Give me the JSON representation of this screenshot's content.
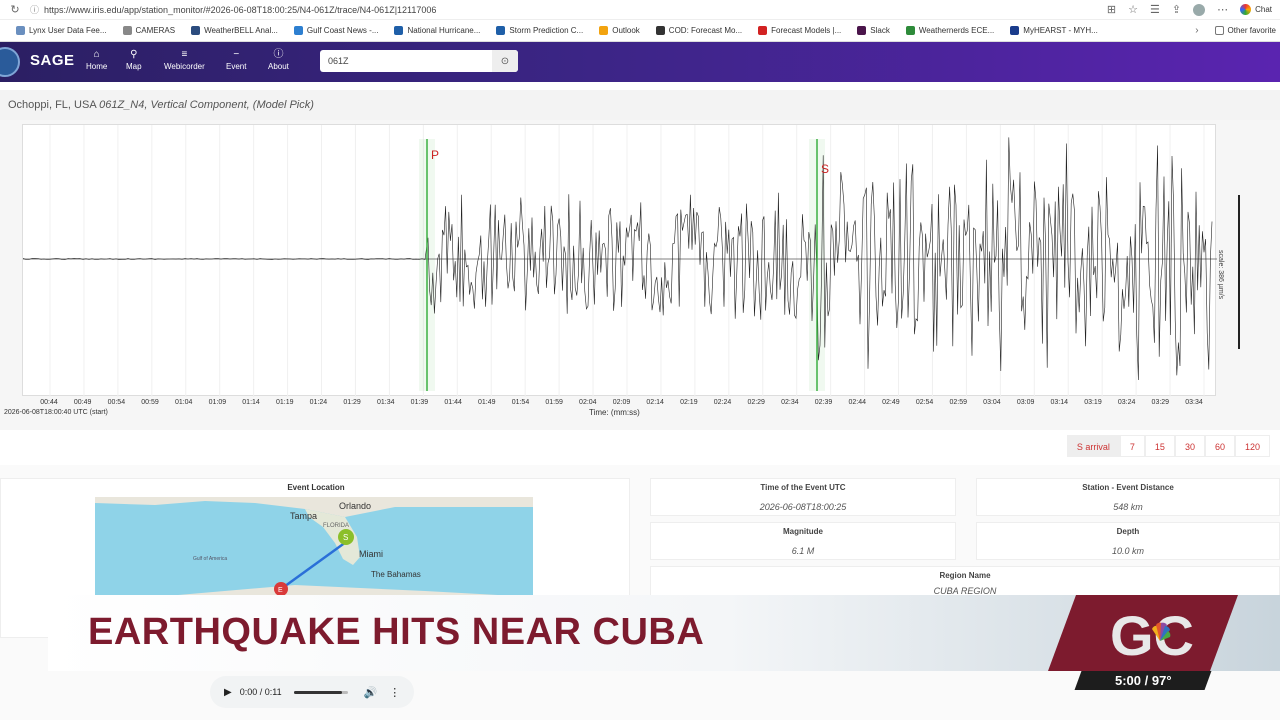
{
  "browser": {
    "url": "https://www.iris.edu/app/station_monitor/#2026-06-08T18:00:25/N4-061Z/trace/N4-061Z|12117006",
    "chat_label": "Chat"
  },
  "bookmarks": [
    {
      "label": "Lynx User Data Fee...",
      "color": "#6a8fbf"
    },
    {
      "label": "CAMERAS",
      "color": "#888888"
    },
    {
      "label": "WeatherBELL Anal...",
      "color": "#2b4c7e"
    },
    {
      "label": "Gulf Coast News -...",
      "color": "#2d7fd0"
    },
    {
      "label": "National Hurricane...",
      "color": "#1f5fa8"
    },
    {
      "label": "Storm Prediction C...",
      "color": "#1f5fa8"
    },
    {
      "label": "Outlook",
      "color": "#f2a30f"
    },
    {
      "label": "COD: Forecast Mo...",
      "color": "#333333"
    },
    {
      "label": "Forecast Models |...",
      "color": "#d22222"
    },
    {
      "label": "Slack",
      "color": "#4a154b"
    },
    {
      "label": "Weathernerds ECE...",
      "color": "#2e8b3a"
    },
    {
      "label": "MyHEARST - MYH...",
      "color": "#1a3c8c"
    }
  ],
  "other_favorites": "Other favorite",
  "sage": {
    "logo": "SAGE",
    "nav": [
      {
        "label": "Home",
        "icon": "home-icon",
        "glyph": "⌂"
      },
      {
        "label": "Map",
        "icon": "map-pin-icon",
        "glyph": "⚲"
      },
      {
        "label": "Webicorder",
        "icon": "list-icon",
        "glyph": "≡"
      },
      {
        "label": "Event",
        "icon": "minus-icon",
        "glyph": "−"
      },
      {
        "label": "About",
        "icon": "info-icon",
        "glyph": "ⓘ"
      }
    ],
    "search_value": "061Z"
  },
  "station": {
    "location": "Ochoppi, FL, USA",
    "title_italic": "061Z_N4, Vertical Component, (Model Pick)"
  },
  "seismogram": {
    "x_ticks": [
      "00:44",
      "00:49",
      "00:54",
      "00:59",
      "01:04",
      "01:09",
      "01:14",
      "01:19",
      "01:24",
      "01:29",
      "01:34",
      "01:39",
      "01:44",
      "01:49",
      "01:54",
      "01:59",
      "02:04",
      "02:09",
      "02:14",
      "02:19",
      "02:24",
      "02:29",
      "02:34",
      "02:39",
      "02:44",
      "02:49",
      "02:54",
      "02:59",
      "03:04",
      "03:09",
      "03:14",
      "03:19",
      "03:24",
      "03:29",
      "03:34"
    ],
    "start_label": "2026-06-08T18:00:40 UTC (start)",
    "xlabel": "Time: (mm:ss)",
    "scale_label": "scale: 386 µm/s",
    "p_label": "P",
    "s_label": "S"
  },
  "time_buttons": [
    "S arrival",
    "7",
    "15",
    "30",
    "60",
    "120"
  ],
  "event_location": {
    "title": "Event Location",
    "map_labels": {
      "orlando": "Orlando",
      "tampa": "Tampa",
      "florida": "FLORIDA",
      "miami": "Miami",
      "bahamas": "The Bahamas",
      "gulf": "Gulf of America",
      "station_marker": "S",
      "event_marker": "E"
    }
  },
  "event_info": {
    "time_label": "Time of the Event UTC",
    "time_value": "2026-06-08T18:00:25",
    "distance_label": "Station - Event Distance",
    "distance_value": "548 km",
    "magnitude_label": "Magnitude",
    "magnitude_value": "6.1 M",
    "depth_label": "Depth",
    "depth_value": "10.0 km",
    "region_label": "Region Name",
    "region_value": "CUBA REGION"
  },
  "banner": {
    "headline": "EARTHQUAKE HITS NEAR CUBA",
    "logo_text": "GC",
    "clock": "5:00 / 97°"
  },
  "audio": {
    "time": "0:00 / 0:11",
    "progress_fraction": 0.9
  },
  "colors": {
    "header_start": "#2b1f63",
    "header_end": "#5a24b0",
    "banner_text": "#7d1b2e",
    "arrival_line": "#3cb043",
    "arrival_text": "#cc2222",
    "logo_bg": "#7d1b2e"
  }
}
